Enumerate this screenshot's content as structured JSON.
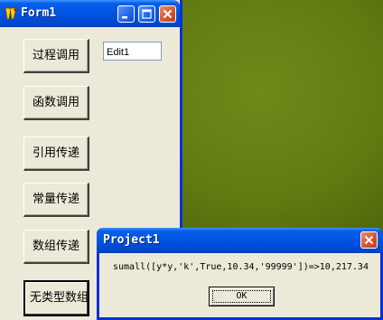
{
  "form1": {
    "title": "Form1",
    "buttons": [
      {
        "label": "过程调用"
      },
      {
        "label": "函数调用"
      },
      {
        "label": "引用传递"
      },
      {
        "label": "常量传递"
      },
      {
        "label": "数组传递"
      },
      {
        "label": "无类型数组"
      }
    ],
    "edit1": {
      "value": "Edit1"
    }
  },
  "dialog": {
    "title": "Project1",
    "message": "sumall([y*y,'k',True,10.34,'99999'])=>10,217.34",
    "ok_label": "OK"
  },
  "colors": {
    "titlebar": "#0054e3",
    "window_face": "#ece9d8",
    "desktop": "#5f7a10",
    "close_button": "#d5522e"
  }
}
